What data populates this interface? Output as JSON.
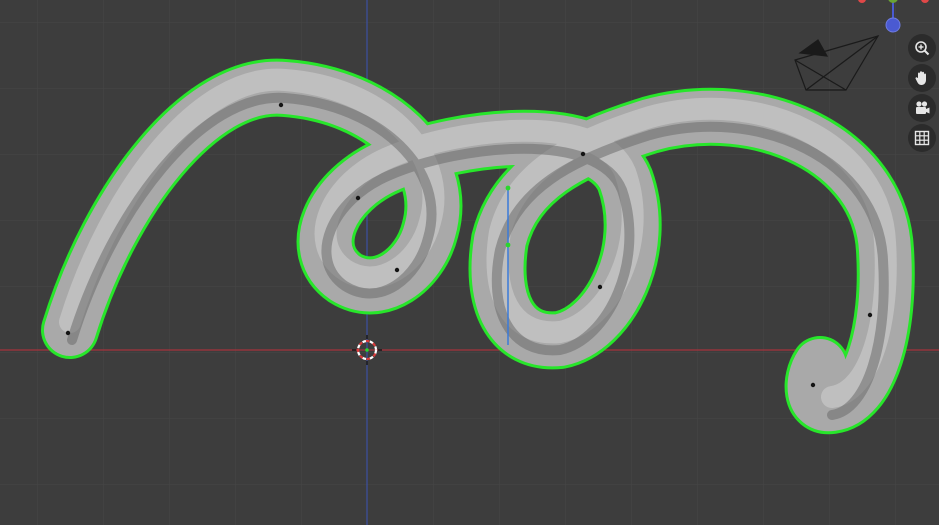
{
  "viewport": {
    "background_color": "#3d3d3d",
    "grid_color": "#474747",
    "x_axis_color": "#a5333c",
    "z_axis_color": "#3c4f9a",
    "selection_outline_color": "#27e62a",
    "mesh_color": "#a9a9a9",
    "control_point_color": "#141414",
    "object": "curve-tube-coil",
    "object_mode": "edit",
    "handle_color": "#3a7ad8",
    "handle_end_color": "#2bd62d"
  },
  "navigation_gizmo": {
    "axes": [
      "x",
      "y",
      "z"
    ],
    "axis_colors": {
      "x": "#e04848",
      "y": "#6aa334",
      "z": "#4a5ad2"
    }
  },
  "navigation_buttons": [
    {
      "name": "zoom",
      "icon": "zoom-icon"
    },
    {
      "name": "pan",
      "icon": "hand-icon"
    },
    {
      "name": "camera-view",
      "icon": "camera-icon"
    },
    {
      "name": "toggle-orthographic",
      "icon": "grid-icon"
    }
  ],
  "scene": {
    "camera_object": "camera-wireframe",
    "cursor": "3d-cursor"
  }
}
